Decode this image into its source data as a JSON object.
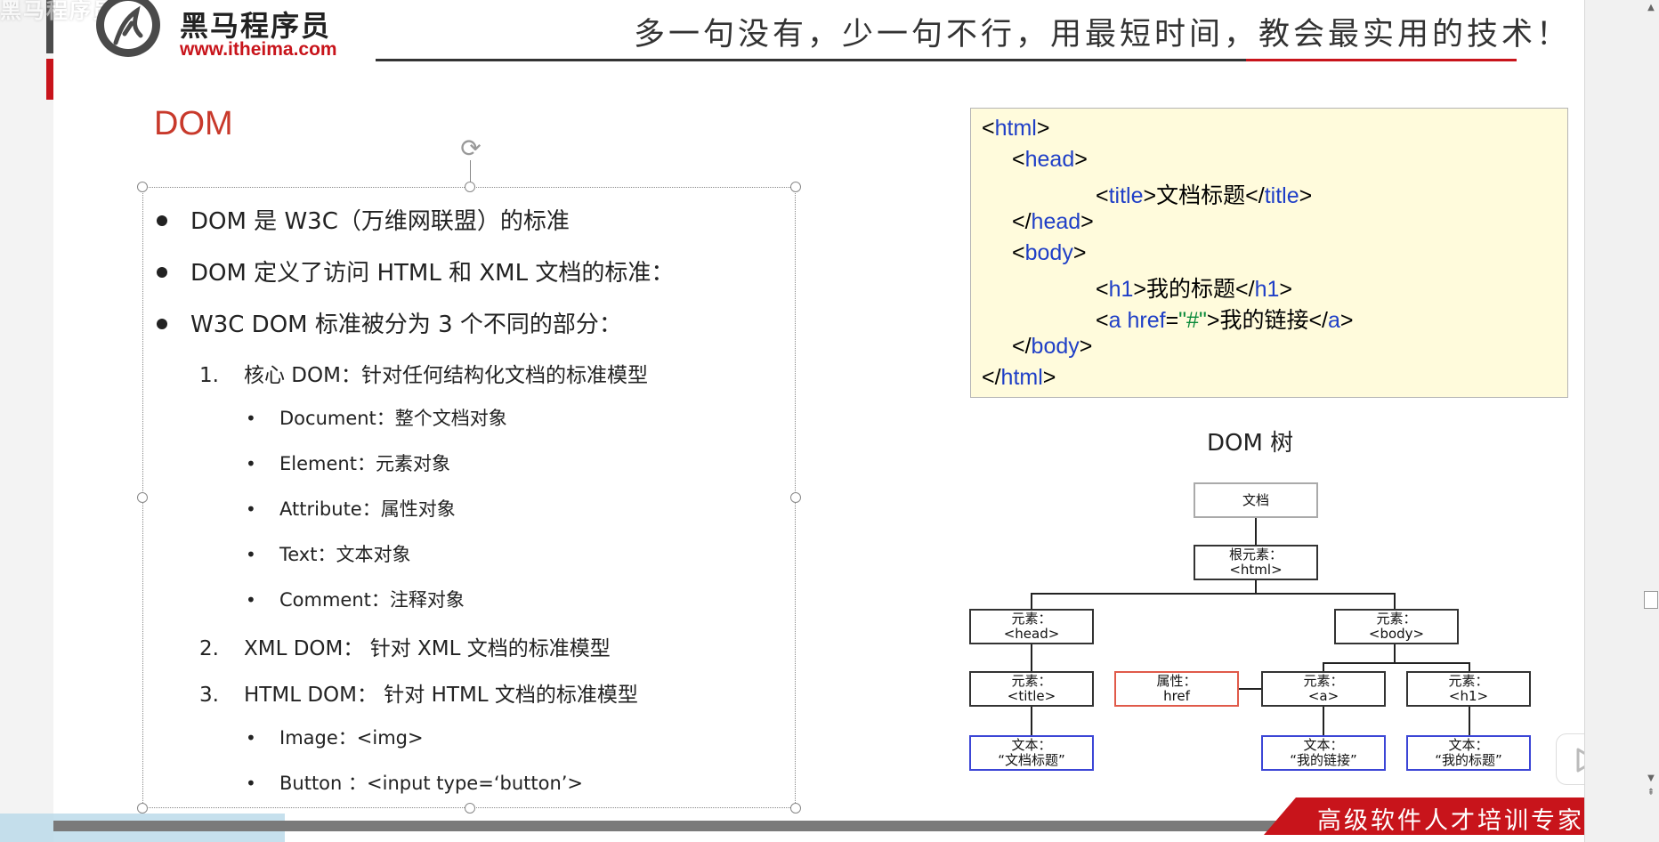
{
  "header": {
    "faded_title": "黑马程序员",
    "brand_name": "黑马程序员",
    "brand_url": "www.itheima.com",
    "slogan": "多一句没有，少一句不行，用最短时间，教会最实用的技术！"
  },
  "slide": {
    "heading": "DOM",
    "bullets": [
      "DOM 是 W3C（万维网联盟）的标准",
      "DOM 定义了访问 HTML 和 XML 文档的标准：",
      "W3C DOM 标准被分为 3 个不同的部分："
    ],
    "parts": [
      {
        "num": "1.",
        "label": "核心 DOM：针对任何结构化文档的标准模型"
      },
      {
        "num": "2.",
        "label": "XML DOM： 针对 XML 文档的标准模型"
      },
      {
        "num": "3.",
        "label": "HTML DOM： 针对 HTML 文档的标准模型"
      }
    ],
    "core_items": [
      "Document：整个文档对象",
      "Element：元素对象",
      "Attribute：属性对象",
      "Text：文本对象",
      "Comment：注释对象"
    ],
    "html_items": [
      "Image：<img>",
      "Button ：<input type=‘button’>"
    ]
  },
  "code": {
    "l1_open": "<",
    "l1_tag": "html",
    "l1_close": ">",
    "l2_tag": "head",
    "l3_tag": "title",
    "l3_text": "文档标题",
    "l4_tag": "head",
    "l5_tag": "body",
    "l6_tag": "h1",
    "l6_text": "我的标题",
    "l7_tag": "a",
    "l7_attr": "href",
    "l7_val": "\"#\"",
    "l7_text": "我的链接",
    "l8_tag": "body",
    "l9_tag": "html",
    "lt": "<",
    "gt": ">",
    "lt_slash": "</",
    "eq": "="
  },
  "tree": {
    "title": "DOM 树",
    "doc": "文档",
    "root_label": "根元素：",
    "root_tag": "<html>",
    "head_label": "元素：",
    "head_tag": "<head>",
    "body_label": "元素：",
    "body_tag": "<body>",
    "title_label": "元素：",
    "title_tag": "<title>",
    "attr_label": "属性：",
    "attr_name": "href",
    "a_label": "元素：",
    "a_tag": "<a>",
    "h1_label": "元素：",
    "h1_tag": "<h1>",
    "text1_label": "文本：",
    "text1_val": "“文档标题”",
    "text2_label": "文本：",
    "text2_val": "“我的链接”",
    "text3_label": "文本：",
    "text3_val": "“我的标题”"
  },
  "footer": {
    "tagline": "高级软件人才培训专家"
  },
  "colors": {
    "accent_red": "#c8141b",
    "heading_red": "#c8392b",
    "code_tag_blue": "#1f3fc7",
    "code_string_green": "#0a8a3a",
    "code_bg": "#fffbdc"
  }
}
